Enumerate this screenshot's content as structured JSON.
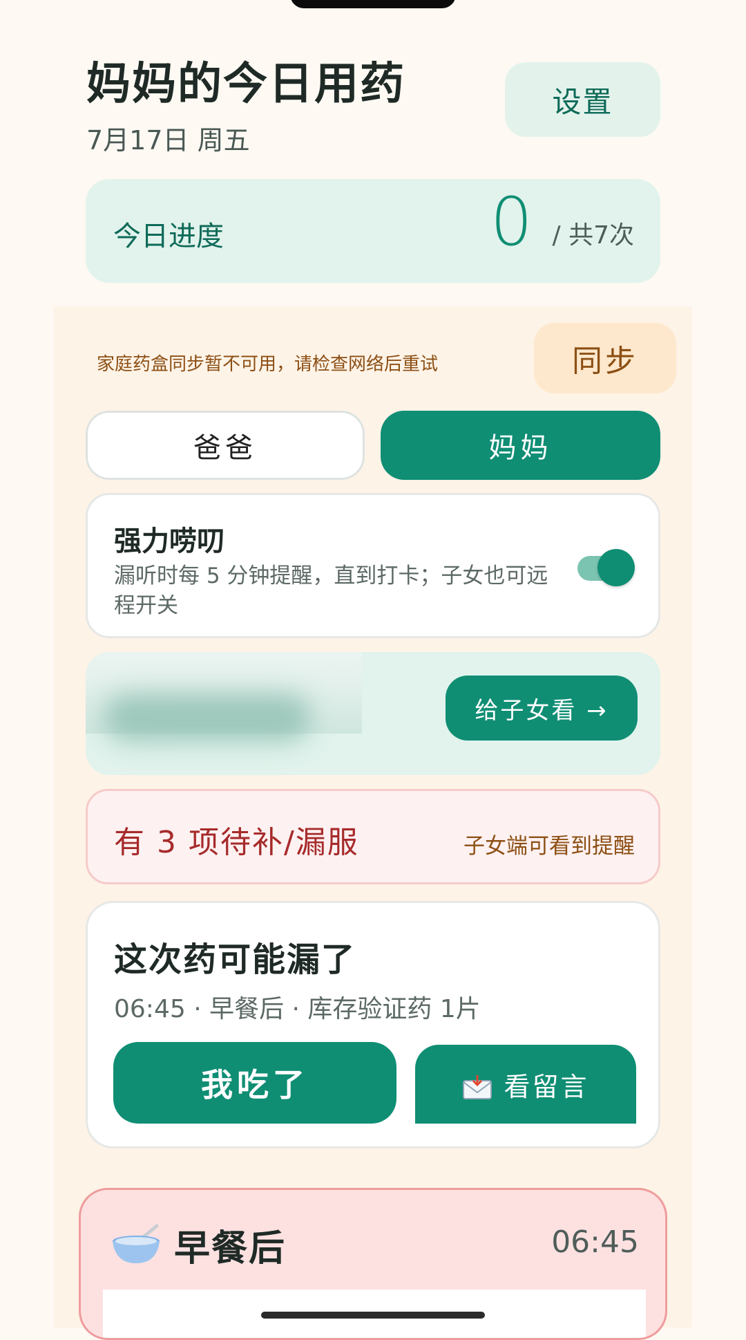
{
  "header": {
    "title": "妈妈的今日用药",
    "date": "7月17日 周五",
    "settings_label": "设置"
  },
  "progress": {
    "label": "今日进度",
    "done": "0",
    "total": "/ 共7次"
  },
  "sync": {
    "message": "家庭药盒同步暂不可用，请检查网络后重试",
    "button": "同步"
  },
  "members": {
    "tabs": [
      {
        "label": "爸爸",
        "selected": false
      },
      {
        "label": "妈妈",
        "selected": true
      }
    ]
  },
  "nag": {
    "title": "强力唠叨",
    "description": "漏听时每 5 分钟提醒，直到打卡；子女也可远程开关",
    "enabled": true
  },
  "share": {
    "button": "给子女看 →"
  },
  "pending": {
    "title": "有 3 项待补/漏服",
    "note": "子女端可看到提醒"
  },
  "dose": {
    "title": "这次药可能漏了",
    "meta": "06:45 · 早餐后 · 库存验证药 1片",
    "ate_button": "我吃了",
    "message_button": "看留言"
  },
  "meal": {
    "title": "早餐后",
    "time": "06:45",
    "icon": "bowl-icon"
  },
  "colors": {
    "primary": "#0F8E74",
    "background": "#FEF9F3",
    "alert": "#A62B2B"
  }
}
